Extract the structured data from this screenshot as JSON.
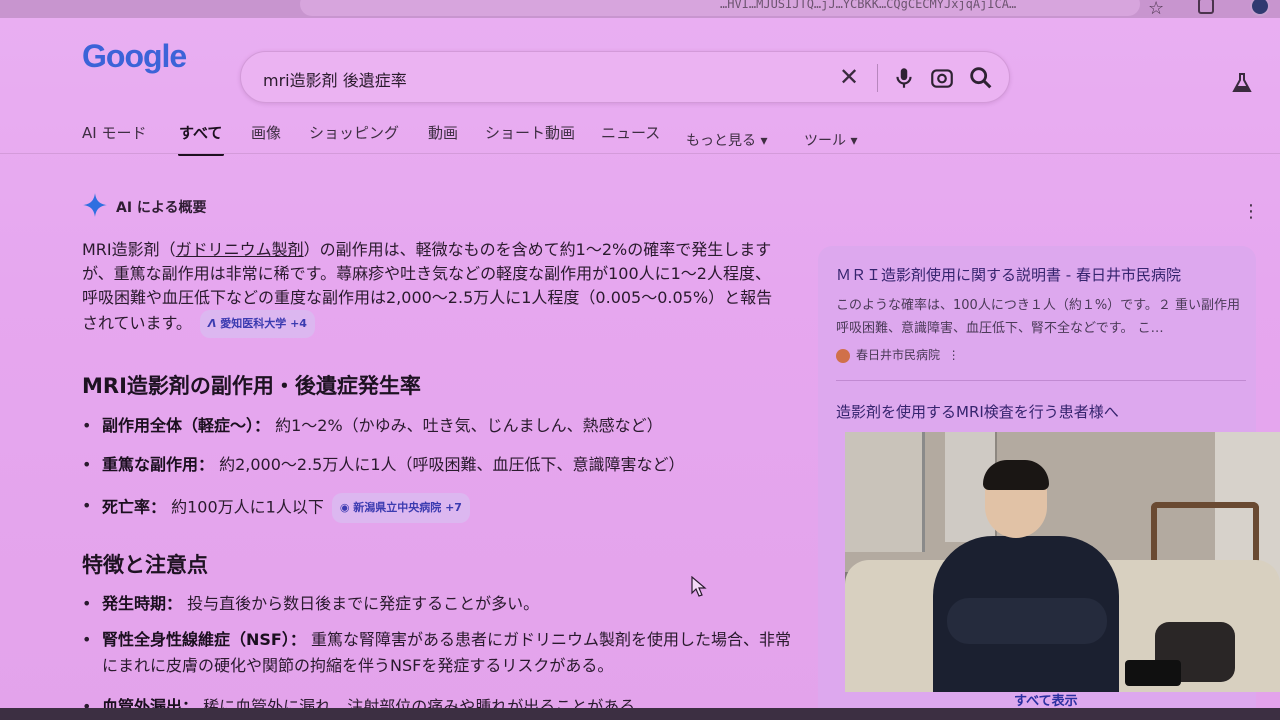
{
  "browser": {
    "url_fragment": "…HVI…MJUSIJTQ…jJ…YCBKK…CQgCECMYJxjqAjICA…"
  },
  "google": {
    "logo_text": "Google",
    "search_query": "mri造影剤 後遺症率"
  },
  "tabs": [
    {
      "label": "AI モード"
    },
    {
      "label": "すべて"
    },
    {
      "label": "画像"
    },
    {
      "label": "ショッピング"
    },
    {
      "label": "動画"
    },
    {
      "label": "ショート動画"
    },
    {
      "label": "ニュース"
    },
    {
      "label": "もっと見る ▾"
    },
    {
      "label": "ツール ▾"
    }
  ],
  "ai_overview": {
    "header": "AI による概要",
    "intro_part1": "MRI造影剤（",
    "intro_term": "ガドリニウム製剤",
    "intro_part2": "）の副作用は、軽微なものを含めて約1〜2%の確率で発生しますが、重篤な副作用は非常に稀です。蕁麻疹や吐き気などの軽度な副作用が100人に1〜2人程度、呼吸困難や血圧低下などの重度な副作用は2,000〜2.5万人に1人程度（0.005〜0.05%）と報告されています。",
    "intro_chip": "愛知医科大学 +4",
    "section1_heading": "MRI造影剤の副作用・後遺症発生率",
    "section1_items": [
      {
        "label": "副作用全体（軽症〜）：",
        "text": " 約1〜2%（かゆみ、吐き気、じんましん、熱感など）"
      },
      {
        "label": "重篤な副作用：",
        "text": " 約2,000〜2.5万人に1人（呼吸困難、血圧低下、意識障害など）"
      },
      {
        "label": "死亡率：",
        "text": " 約100万人に1人以下",
        "chip": "新潟県立中央病院 +7"
      }
    ],
    "section2_heading": "特徴と注意点",
    "section2_items": [
      {
        "label": "発生時期：",
        "text": " 投与直後から数日後までに発症することが多い。"
      },
      {
        "label": "腎性全身性線維症（NSF）：",
        "text": " 重篤な腎障害がある患者にガドリニウム製剤を使用した場合、非常にまれに皮膚の硬化や関節の拘縮を伴うNSFを発症するリスクがある。"
      },
      {
        "label": "血管外漏出：",
        "text": " 稀に血管外に漏れ、注射部位の痛みや腫れが出ることがある。"
      }
    ]
  },
  "sources": {
    "card1_title": "ＭＲＩ造影剤使用に関する説明書 - 春日井市民病院",
    "card1_desc": "このような確率は、100人につき１人（約１%）です。２ 重い副作用 呼吸困難、意識障害、血圧低下、腎不全などです。 こ…",
    "card1_site": "春日井市民病院",
    "card2_title": "造影剤を使用するMRI検査を行う患者様へ",
    "show_all": "すべて表示"
  },
  "colors": {
    "page_tint": "#e6a9ef",
    "link_blue": "#36246e",
    "chip_bg": "#dcb7f0",
    "sparkle_blue": "#2f6fe0"
  }
}
